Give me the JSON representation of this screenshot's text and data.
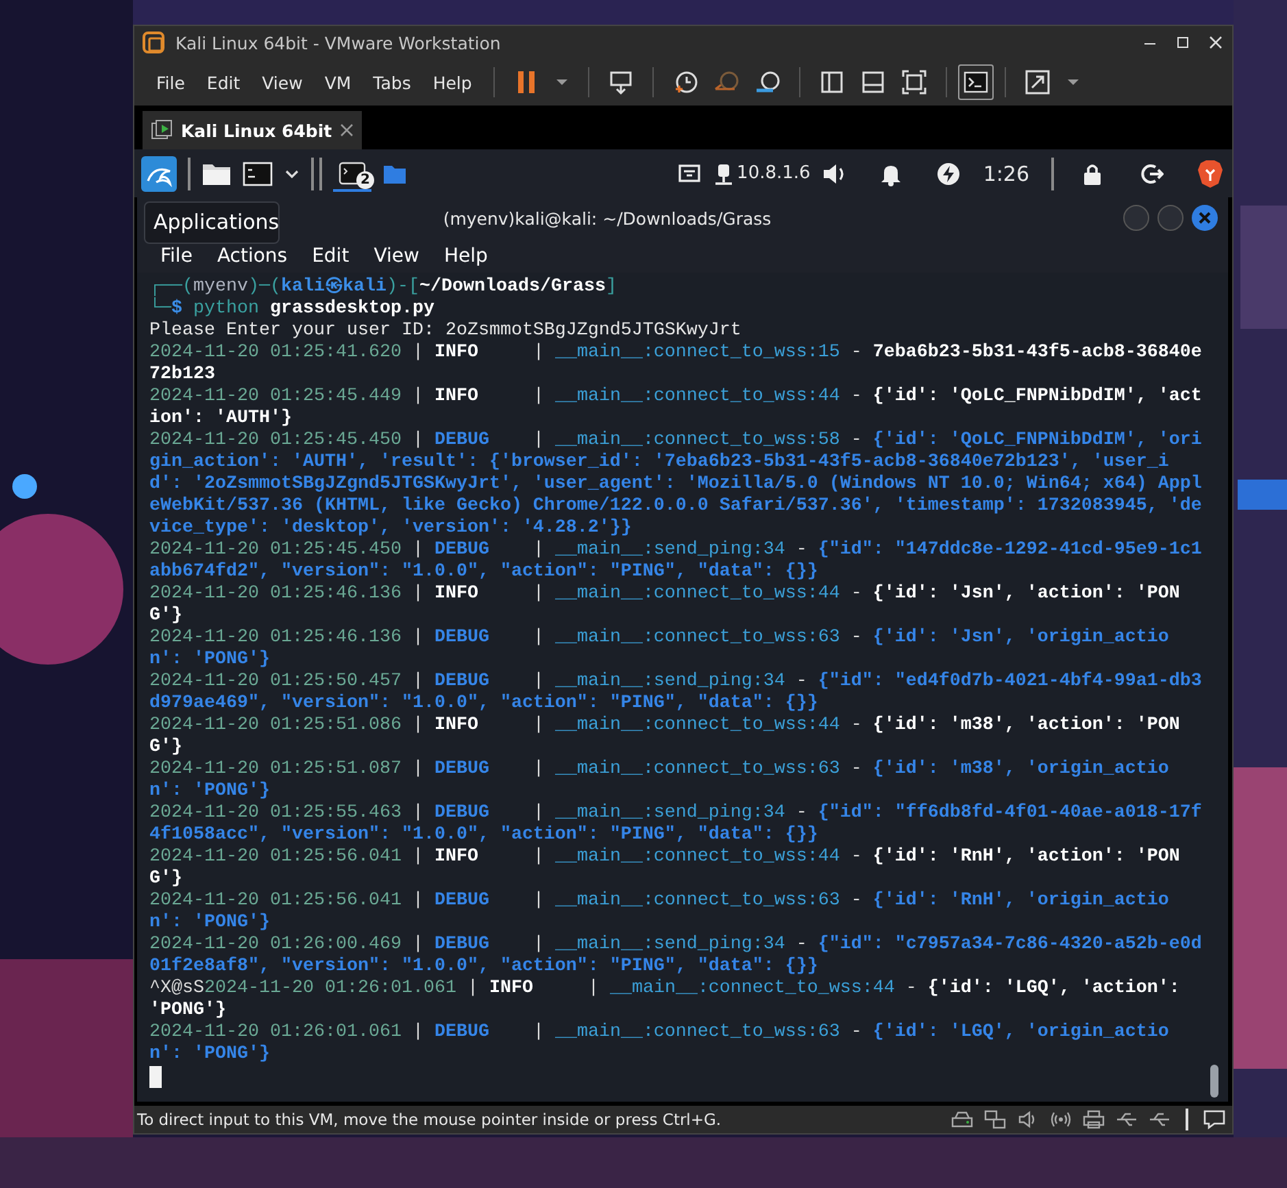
{
  "window": {
    "title": "Kali Linux 64bit - VMware Workstation"
  },
  "menu": [
    "File",
    "Edit",
    "View",
    "VM",
    "Tabs",
    "Help"
  ],
  "tabs": [
    {
      "label": "Kali Linux 64bit",
      "selected": true
    }
  ],
  "kali_panel": {
    "workspace_badge": "2",
    "ip": "10.8.1.6",
    "clock": "1:26"
  },
  "tooltip": "Applications",
  "terminal": {
    "title": "(myenv)kali@kali: ~/Downloads/Grass",
    "menu": [
      "File",
      "Actions",
      "Edit",
      "View",
      "Help"
    ],
    "prompt": [
      [
        {
          "text": "┌──(",
          "kind": "frame"
        },
        {
          "text": "myenv",
          "kind": "env"
        },
        {
          "text": ")─(",
          "kind": "frame"
        },
        {
          "text": "kali㉿kali",
          "kind": "user"
        },
        {
          "text": ")-[",
          "kind": "frame"
        },
        {
          "text": "~/Downloads/Grass",
          "kind": "path"
        },
        {
          "text": "]",
          "kind": "frame"
        }
      ],
      [
        {
          "text": "└─",
          "kind": "frame"
        },
        {
          "text": "$ ",
          "kind": "dollar"
        },
        {
          "text": "python ",
          "kind": "cmd"
        },
        {
          "text": "grassdesktop.py",
          "kind": "path"
        }
      ]
    ],
    "output": "Please Enter your user ID: 2oZsmmotSBgJZgnd5JTGSKwyJrt",
    "logs": [
      {
        "time": "2024-11-20 01:25:41.620",
        "sep1": "|",
        "level": "INFO",
        "kind": "info",
        "sep2": "|",
        "source": "__main__:connect_to_wss:15",
        "sep3": "-",
        "message": "7eba6b23-5b31-43f5-acb8-36840e72b123"
      },
      {
        "time": "2024-11-20 01:25:45.449",
        "sep1": "|",
        "level": "INFO",
        "kind": "info",
        "sep2": "|",
        "source": "__main__:connect_to_wss:44",
        "sep3": "-",
        "message": "{'id': 'QoLC_FNPNibDdIM', 'action': 'AUTH'}"
      },
      {
        "time": "2024-11-20 01:25:45.450",
        "sep1": "|",
        "level": "DEBUG",
        "kind": "debug",
        "sep2": "|",
        "source": "__main__:connect_to_wss:58",
        "sep3": "-",
        "message": "{'id': 'QoLC_FNPNibDdIM', 'origin_action': 'AUTH', 'result': {'browser_id': '7eba6b23-5b31-43f5-acb8-36840e72b123', 'user_id': '2oZsmmotSBgJZgnd5JTGSKwyJrt', 'user_agent': 'Mozilla/5.0 (Windows NT 10.0; Win64; x64) AppleWebKit/537.36 (KHTML, like Gecko) Chrome/122.0.0.0 Safari/537.36', 'timestamp': 1732083945, 'device_type': 'desktop', 'version': '4.28.2'}}"
      },
      {
        "time": "2024-11-20 01:25:45.450",
        "sep1": "|",
        "level": "DEBUG",
        "kind": "debug",
        "sep2": "|",
        "source": "__main__:send_ping:34",
        "sep3": "-",
        "message": "{\"id\": \"147ddc8e-1292-41cd-95e9-1c1abb674fd2\", \"version\": \"1.0.0\", \"action\": \"PING\", \"data\": {}}"
      },
      {
        "time": "2024-11-20 01:25:46.136",
        "sep1": "|",
        "level": "INFO",
        "kind": "info",
        "sep2": "|",
        "source": "__main__:connect_to_wss:44",
        "sep3": "-",
        "message": "{'id': 'Jsn', 'action': 'PONG'}"
      },
      {
        "time": "2024-11-20 01:25:46.136",
        "sep1": "|",
        "level": "DEBUG",
        "kind": "debug",
        "sep2": "|",
        "source": "__main__:connect_to_wss:63",
        "sep3": "-",
        "message": "{'id': 'Jsn', 'origin_action': 'PONG'}"
      },
      {
        "time": "2024-11-20 01:25:50.457",
        "sep1": "|",
        "level": "DEBUG",
        "kind": "debug",
        "sep2": "|",
        "source": "__main__:send_ping:34",
        "sep3": "-",
        "message": "{\"id\": \"ed4f0d7b-4021-4bf4-99a1-db3d979ae469\", \"version\": \"1.0.0\", \"action\": \"PING\", \"data\": {}}"
      },
      {
        "time": "2024-11-20 01:25:51.086",
        "sep1": "|",
        "level": "INFO",
        "kind": "info",
        "sep2": "|",
        "source": "__main__:connect_to_wss:44",
        "sep3": "-",
        "message": "{'id': 'm38', 'action': 'PONG'}"
      },
      {
        "time": "2024-11-20 01:25:51.087",
        "sep1": "|",
        "level": "DEBUG",
        "kind": "debug",
        "sep2": "|",
        "source": "__main__:connect_to_wss:63",
        "sep3": "-",
        "message": "{'id': 'm38', 'origin_action': 'PONG'}"
      },
      {
        "time": "2024-11-20 01:25:55.463",
        "sep1": "|",
        "level": "DEBUG",
        "kind": "debug",
        "sep2": "|",
        "source": "__main__:send_ping:34",
        "sep3": "-",
        "message": "{\"id\": \"ff6db8fd-4f01-40ae-a018-17f4f1058acc\", \"version\": \"1.0.0\", \"action\": \"PING\", \"data\": {}}"
      },
      {
        "time": "2024-11-20 01:25:56.041",
        "sep1": "|",
        "level": "INFO",
        "kind": "info",
        "sep2": "|",
        "source": "__main__:connect_to_wss:44",
        "sep3": "-",
        "message": "{'id': 'RnH', 'action': 'PONG'}"
      },
      {
        "time": "2024-11-20 01:25:56.041",
        "sep1": "|",
        "level": "DEBUG",
        "kind": "debug",
        "sep2": "|",
        "source": "__main__:connect_to_wss:63",
        "sep3": "-",
        "message": "{'id': 'RnH', 'origin_action': 'PONG'}"
      },
      {
        "time": "2024-11-20 01:26:00.469",
        "sep1": "|",
        "level": "DEBUG",
        "kind": "debug",
        "sep2": "|",
        "source": "__main__:send_ping:34",
        "sep3": "-",
        "message": "{\"id\": \"c7957a34-7c86-4320-a52b-e0d01f2e8af8\", \"version\": \"1.0.0\", \"action\": \"PING\", \"data\": {}}"
      },
      {
        "prefix": "^X@sS",
        "time": "2024-11-20 01:26:01.061",
        "sep1": "|",
        "level": "INFO",
        "kind": "info",
        "sep2": "|",
        "source": "__main__:connect_to_wss:44",
        "sep3": "-",
        "message": "{'id': 'LGQ', 'action': 'PONG'}"
      },
      {
        "time": "2024-11-20 01:26:01.061",
        "sep1": "|",
        "level": "DEBUG",
        "kind": "debug",
        "sep2": "|",
        "source": "__main__:connect_to_wss:63",
        "sep3": "-",
        "message": "{'id': 'LGQ', 'origin_action': 'PONG'}"
      }
    ]
  },
  "status_bar": "To direct input to this VM, move the mouse pointer inside or press Ctrl+G."
}
